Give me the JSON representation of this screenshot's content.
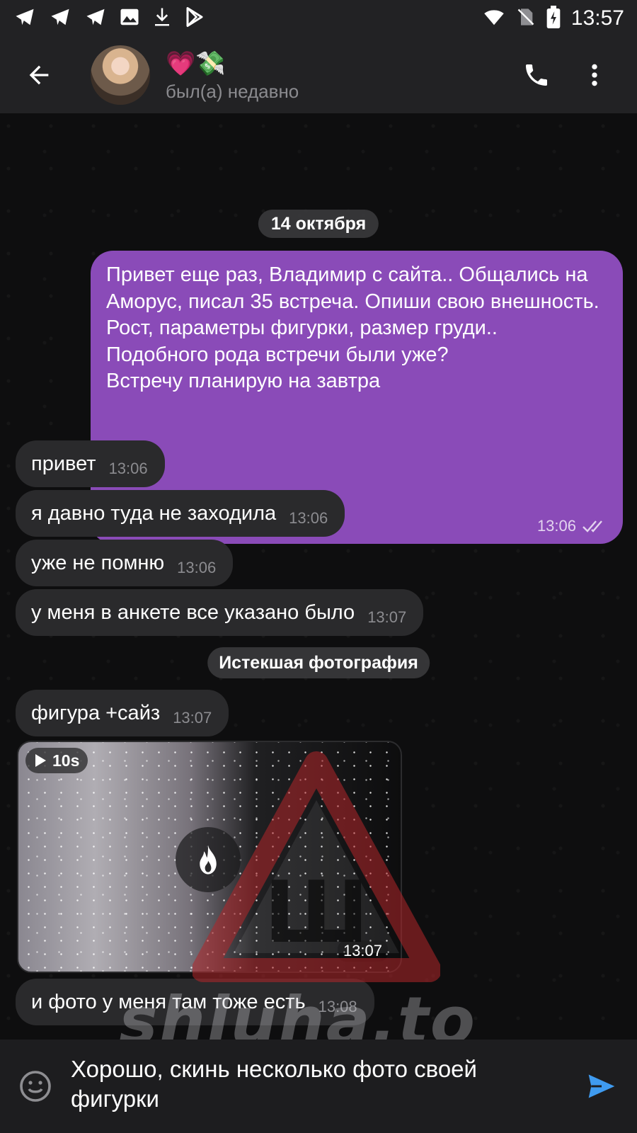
{
  "status_bar": {
    "time": "13:57",
    "left_icons": [
      "telegram-icon",
      "telegram-icon",
      "telegram-icon",
      "image-icon",
      "download-icon",
      "play-store-icon"
    ],
    "right_icons": [
      "wifi-icon",
      "no-sim-icon",
      "battery-icon"
    ]
  },
  "header": {
    "back_icon": "arrow-left-icon",
    "name": "💗💸",
    "status": "был(а) недавно",
    "call_icon": "phone-icon",
    "menu_icon": "more-vertical-icon"
  },
  "chat": {
    "date": "14 октября",
    "outgoing": {
      "text": "Привет еще раз, Владимир с сайта.. Общались на Аморус, писал 35 встреча. Опиши свою внешность. Рост, параметры фигурки, размер груди..\nПодобного рода встречи были уже?\nВстречу планирую на завтра",
      "time": "13:06",
      "status_icon": "double-check-icon"
    },
    "incoming": [
      {
        "text": "привет",
        "time": "13:06"
      },
      {
        "text": "я давно туда не заходила",
        "time": "13:06"
      },
      {
        "text": "уже не помню",
        "time": "13:06"
      },
      {
        "text": "у меня в анкете все указано было",
        "time": "13:07"
      }
    ],
    "service_message": "Истекшая фотография",
    "incoming2": [
      {
        "text": "фигура +сайз",
        "time": "13:07"
      }
    ],
    "media": {
      "duration": "10s",
      "time": "13:07",
      "icon": "flame-icon"
    },
    "incoming3": [
      {
        "text": "и фото у меня там тоже есть",
        "time": "13:08"
      }
    ]
  },
  "overlay": {
    "warning_letter": "Ш",
    "watermark": "shluha.to"
  },
  "input": {
    "text": "Хорошо, скинь несколько фото своей фигурки",
    "emoji_icon": "smile-icon",
    "send_icon": "send-icon"
  },
  "colors": {
    "outgoing_bubble": "#8a4bb8",
    "incoming_bubble": "#2a2a2c",
    "send_button": "#3f9bf0",
    "header_bg": "#222224"
  }
}
